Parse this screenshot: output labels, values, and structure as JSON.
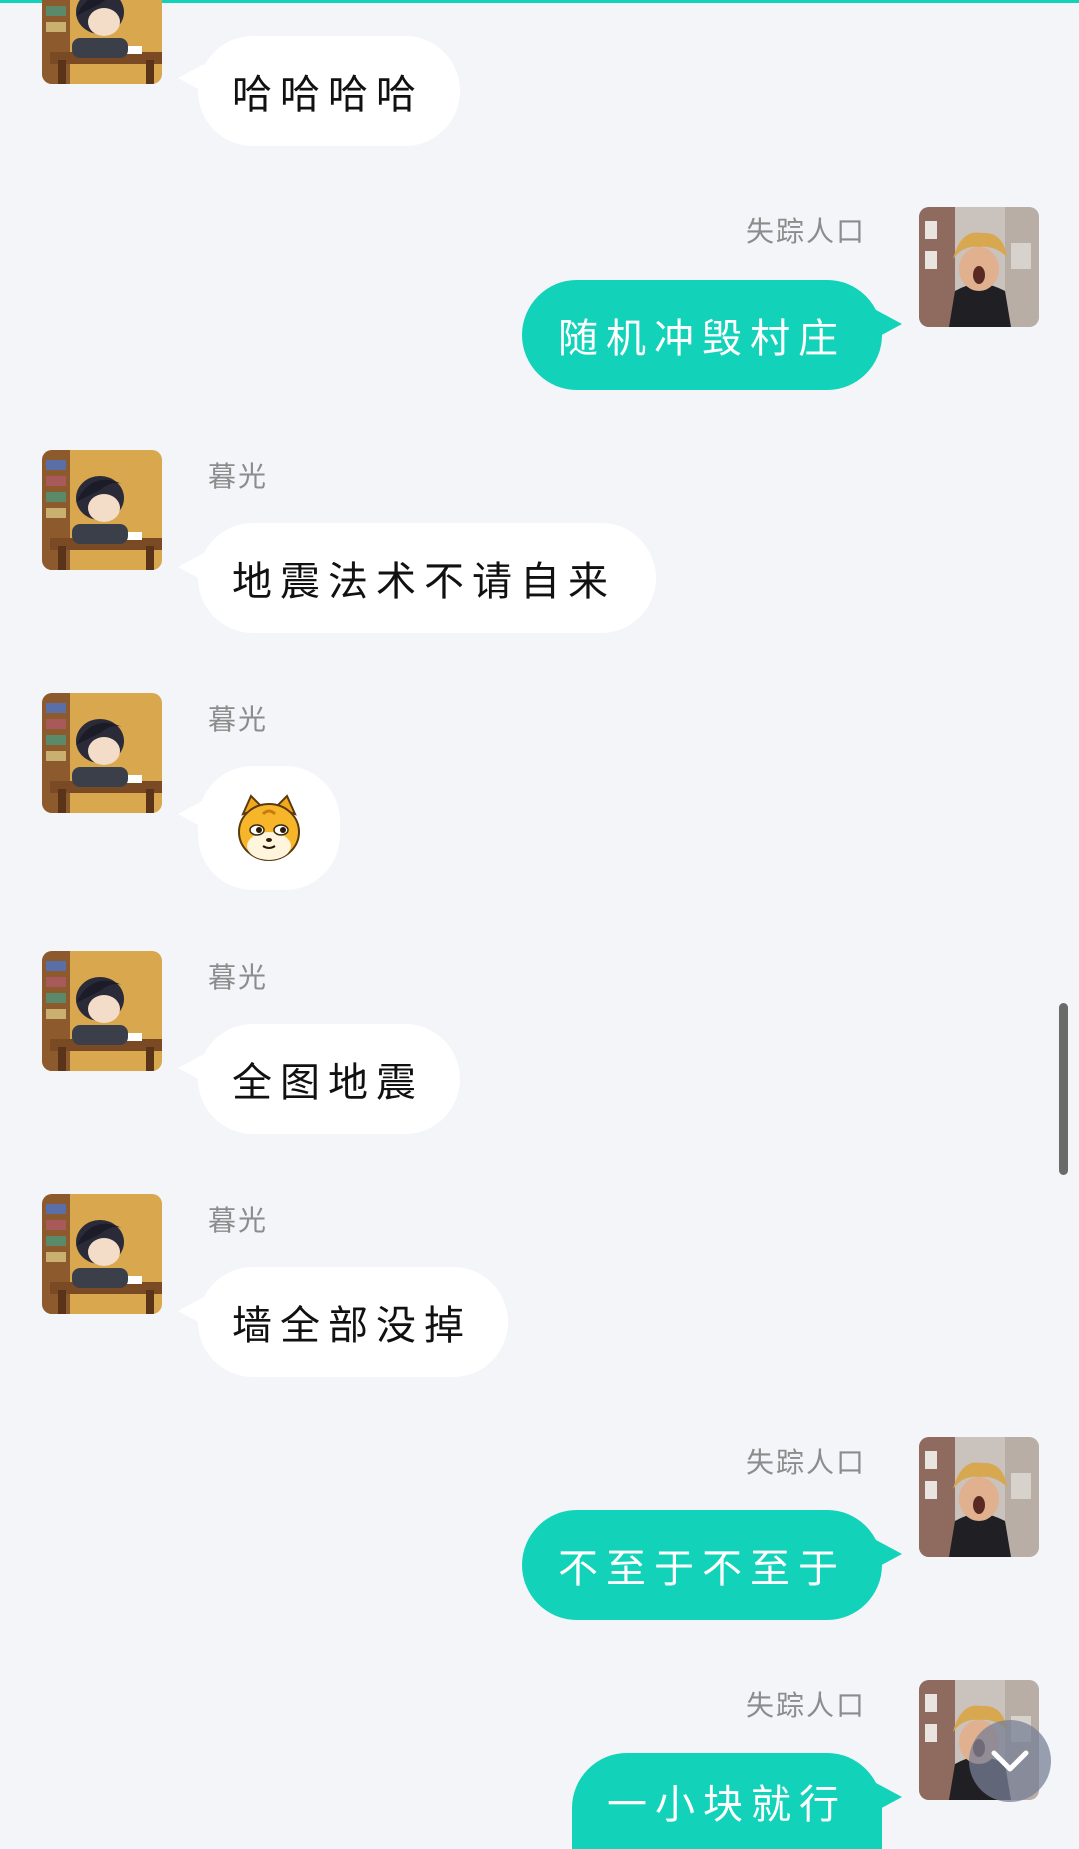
{
  "messages": [
    {
      "side": "in",
      "sender": "",
      "text": "哈哈哈哈"
    },
    {
      "side": "out",
      "sender": "失踪人口",
      "text": "随机冲毁村庄"
    },
    {
      "side": "in",
      "sender": "暮光",
      "text": "地震法术不请自来"
    },
    {
      "side": "in",
      "sender": "暮光",
      "emoji": "fox-sticker-icon"
    },
    {
      "side": "in",
      "sender": "暮光",
      "text": "全图地震"
    },
    {
      "side": "in",
      "sender": "暮光",
      "text": "墙全部没掉"
    },
    {
      "side": "out",
      "sender": "失踪人口",
      "text": "不至于不至于"
    },
    {
      "side": "out",
      "sender": "失踪人口",
      "text": "一小块就行"
    }
  ],
  "colors": {
    "accent": "#12d3b9",
    "background": "#f3f5f9",
    "incoming_bubble": "#ffffff",
    "outgoing_text": "#ffffff",
    "sender_name": "#8c8c8c"
  },
  "icons": {
    "scroll_down": "chevron-down-icon",
    "incoming_avatar": "anime-student-at-desk-avatar",
    "outgoing_avatar": "person-in-hat-photo-avatar"
  }
}
